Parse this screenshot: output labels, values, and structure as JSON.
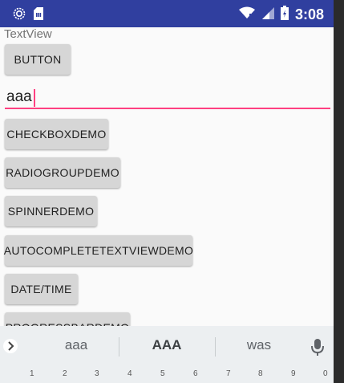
{
  "status_bar": {
    "time": "3:08",
    "icons": [
      "settings-gear-icon",
      "sim-card-icon",
      "wifi-icon",
      "signal-icon",
      "battery-icon"
    ]
  },
  "content": {
    "textview": "TextView",
    "button": "BUTTON",
    "edit_text_value": "aaa",
    "buttons": [
      "CHECKBOXDEMO",
      "RADIOGROUPDEMO",
      "SPINNERDEMO",
      "AUTOCOMPLETETEXTVIEWDEMO",
      "DATE/TIME",
      "PROGRESSBARDEMO"
    ]
  },
  "keyboard": {
    "suggestions": [
      "aaa",
      "AAA",
      "was"
    ],
    "digits": [
      "1",
      "2",
      "3",
      "4",
      "5",
      "6",
      "7",
      "8",
      "9",
      "0"
    ],
    "accent": "#ff4081",
    "status_bar_color": "#303f9f"
  }
}
